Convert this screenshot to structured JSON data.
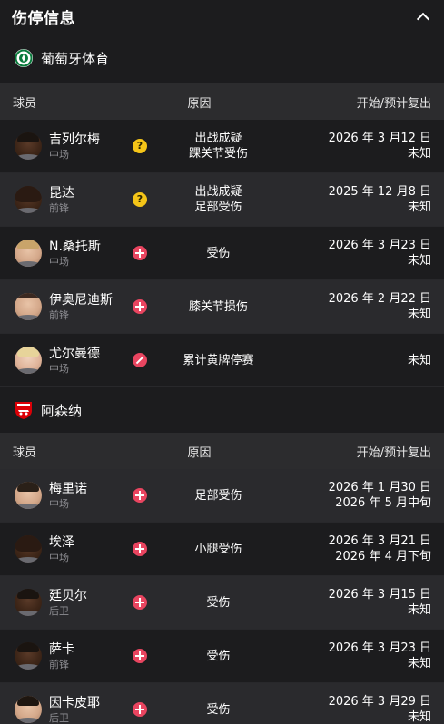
{
  "header": {
    "title": "伤停信息"
  },
  "columns": {
    "player": "球员",
    "reason": "原因",
    "dates": "开始/预计复出"
  },
  "teams": [
    {
      "name": "葡萄牙体育",
      "players": [
        {
          "name": "吉列尔梅",
          "pos": "中场",
          "status": "doubtful",
          "reason1": "出战成疑",
          "reason2": "踝关节受伤",
          "date1": "2026 年 3 月12 日",
          "date2": "未知"
        },
        {
          "name": "昆达",
          "pos": "前锋",
          "status": "doubtful",
          "reason1": "出战成疑",
          "reason2": "足部受伤",
          "date1": "2025 年 12 月8 日",
          "date2": "未知"
        },
        {
          "name": "N.桑托斯",
          "pos": "中场",
          "status": "injury",
          "reason1": "受伤",
          "reason2": "",
          "date1": "2026 年 3 月23 日",
          "date2": "未知"
        },
        {
          "name": "伊奥尼迪斯",
          "pos": "前锋",
          "status": "injury",
          "reason1": "膝关节损伤",
          "reason2": "",
          "date1": "2026 年 2 月22 日",
          "date2": "未知"
        },
        {
          "name": "尤尔曼德",
          "pos": "中场",
          "status": "suspension",
          "reason1": "累计黄牌停赛",
          "reason2": "",
          "date1": "",
          "date2": "未知"
        }
      ]
    },
    {
      "name": "阿森纳",
      "players": [
        {
          "name": "梅里诺",
          "pos": "中场",
          "status": "injury",
          "reason1": "足部受伤",
          "reason2": "",
          "date1": "2026 年 1 月30 日",
          "date2": "2026 年 5 月中旬"
        },
        {
          "name": "埃泽",
          "pos": "中场",
          "status": "injury",
          "reason1": "小腿受伤",
          "reason2": "",
          "date1": "2026 年 3 月21 日",
          "date2": "2026 年 4 月下旬"
        },
        {
          "name": "廷贝尔",
          "pos": "后卫",
          "status": "injury",
          "reason1": "受伤",
          "reason2": "",
          "date1": "2026 年 3 月15 日",
          "date2": "未知"
        },
        {
          "name": "萨卡",
          "pos": "前锋",
          "status": "injury",
          "reason1": "受伤",
          "reason2": "",
          "date1": "2026 年 3 月23 日",
          "date2": "未知"
        },
        {
          "name": "因卡皮耶",
          "pos": "后卫",
          "status": "injury",
          "reason1": "受伤",
          "reason2": "",
          "date1": "2026 年 3 月29 日",
          "date2": "未知"
        }
      ]
    }
  ],
  "colors": {
    "background": "#1c1c1e",
    "row_alt": "#2a2a2d",
    "header_bar": "#2c2c2e",
    "doubtful": "#f5c518",
    "injury": "#e94560",
    "sporting_green": "#0a7a3c",
    "arsenal_red": "#db0007"
  },
  "icons": {
    "collapse": "chevron-up-icon",
    "doubtful": "question-icon",
    "injury": "cross-icon",
    "suspension": "card-icon"
  }
}
